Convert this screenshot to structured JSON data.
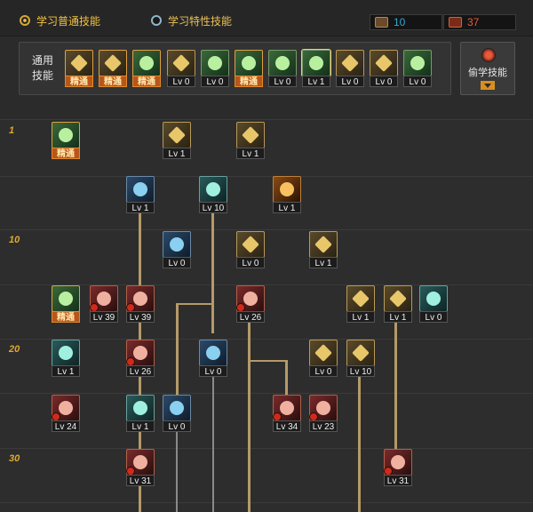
{
  "tabs": {
    "normal": "学习普通技能",
    "special": "学习特性技能"
  },
  "counters": {
    "sp": "10",
    "tp": "37"
  },
  "generic": {
    "label_line1": "通用",
    "label_line2": "技能",
    "skills": [
      {
        "text": "精通",
        "master": true,
        "tone": "t-gold"
      },
      {
        "text": "精通",
        "master": true,
        "tone": "t-gold"
      },
      {
        "text": "精通",
        "master": true,
        "tone": "t-green"
      },
      {
        "text": "Lv 0",
        "master": false,
        "tone": "t-gold"
      },
      {
        "text": "Lv 0",
        "master": false,
        "tone": "t-green"
      },
      {
        "text": "精通",
        "master": true,
        "tone": "t-green"
      },
      {
        "text": "Lv 0",
        "master": false,
        "tone": "t-green"
      },
      {
        "text": "Lv 1",
        "master": false,
        "tone": "t-green",
        "selected": true
      },
      {
        "text": "Lv 0",
        "master": false,
        "tone": "t-gold"
      },
      {
        "text": "Lv 0",
        "master": false,
        "tone": "t-gold"
      },
      {
        "text": "Lv 0",
        "master": false,
        "tone": "t-green"
      }
    ]
  },
  "steal_button": "偷学技能",
  "levels": [
    "1",
    "10",
    "20",
    "30"
  ],
  "tree": [
    {
      "text": "精通",
      "master": true,
      "tone": "t-green"
    },
    {
      "text": "Lv 1",
      "tone": "t-gold"
    },
    {
      "text": "Lv 1",
      "tone": "t-gold"
    },
    {
      "text": "Lv 1",
      "tone": "t-blue"
    },
    {
      "text": "Lv 10",
      "tone": "t-teal"
    },
    {
      "text": "Lv 1",
      "tone": "t-fire"
    },
    {
      "text": "Lv 0",
      "tone": "t-blue"
    },
    {
      "text": "Lv 0",
      "tone": "t-gold"
    },
    {
      "text": "Lv 1",
      "tone": "t-gold"
    },
    {
      "text": "精通",
      "master": true,
      "tone": "t-green"
    },
    {
      "text": "Lv 39",
      "tone": "t-red",
      "lock": true
    },
    {
      "text": "Lv 39",
      "tone": "t-red",
      "lock": true
    },
    {
      "text": "Lv 26",
      "tone": "t-red",
      "lock": true
    },
    {
      "text": "Lv 1",
      "tone": "t-gold"
    },
    {
      "text": "Lv 1",
      "tone": "t-gold"
    },
    {
      "text": "Lv 0",
      "tone": "t-teal"
    },
    {
      "text": "Lv 1",
      "tone": "t-teal"
    },
    {
      "text": "Lv 26",
      "tone": "t-red",
      "lock": true
    },
    {
      "text": "Lv 0",
      "tone": "t-blue"
    },
    {
      "text": "Lv 0",
      "tone": "t-gold"
    },
    {
      "text": "Lv 10",
      "tone": "t-gold"
    },
    {
      "text": "Lv 24",
      "tone": "t-red",
      "lock": true
    },
    {
      "text": "Lv 1",
      "tone": "t-teal"
    },
    {
      "text": "Lv 0",
      "tone": "t-blue"
    },
    {
      "text": "Lv 34",
      "tone": "t-red",
      "lock": true
    },
    {
      "text": "Lv 23",
      "tone": "t-red",
      "lock": true
    },
    {
      "text": "Lv 31",
      "tone": "t-red",
      "lock": true
    },
    {
      "text": "Lv 31",
      "tone": "t-red",
      "lock": true
    }
  ]
}
